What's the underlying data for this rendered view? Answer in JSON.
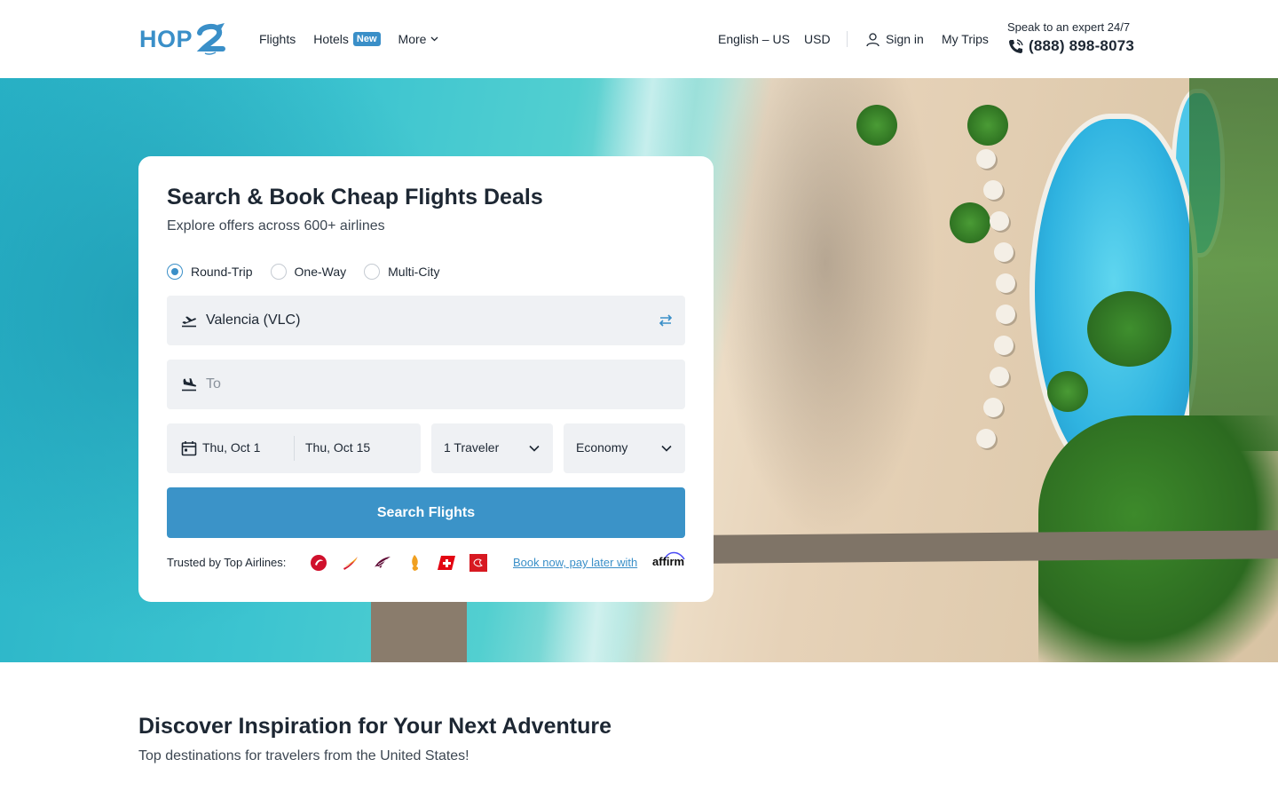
{
  "header": {
    "logo_text": "HOP",
    "nav": {
      "flights": "Flights",
      "hotels": "Hotels",
      "hotels_badge": "New",
      "more": "More"
    },
    "language": "English – US",
    "currency": "USD",
    "sign_in": "Sign in",
    "my_trips": "My Trips",
    "expert_label": "Speak to an expert 24/7",
    "phone": "(888) 898-8073"
  },
  "search": {
    "title": "Search & Book Cheap Flights Deals",
    "subtitle": "Explore offers across 600+ airlines",
    "trip_types": [
      "Round-Trip",
      "One-Way",
      "Multi-City"
    ],
    "selected_trip_type": "Round-Trip",
    "from_value": "Valencia (VLC)",
    "to_placeholder": "To",
    "depart_date": "Thu, Oct 1",
    "return_date": "Thu, Oct 15",
    "travelers": "1 Traveler",
    "cabin_class": "Economy",
    "search_button": "Search Flights",
    "trusted_label": "Trusted by Top Airlines:",
    "airline_icons": [
      "turkish-airlines-logo",
      "iberia-logo",
      "qatar-airways-logo",
      "singapore-airlines-logo",
      "swiss-logo",
      "emirates-logo"
    ],
    "pay_later_link": "Book now, pay later with",
    "affirm_text": "affirm"
  },
  "discover": {
    "title": "Discover Inspiration for Your Next Adventure",
    "subtitle": "Top destinations for travelers from the United States!"
  },
  "colors": {
    "brand_blue": "#3a8fc8",
    "button_blue": "#3b93c8",
    "field_bg": "#eff1f4",
    "text_dark": "#1d2733"
  }
}
